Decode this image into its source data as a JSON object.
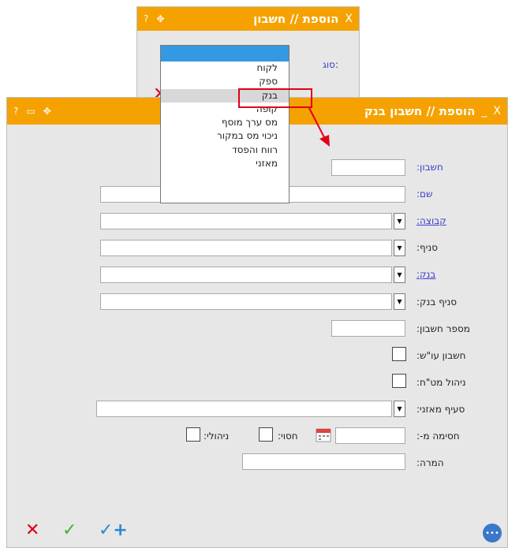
{
  "type_dialog": {
    "title": "הוספת // חשבון",
    "close": "X",
    "help": "?",
    "move": "✥",
    "type_label": "סוג:",
    "cancel_icon": "✕"
  },
  "type_dropdown": {
    "options": [
      "לקוח",
      "ספק",
      "בנק",
      "קופה",
      "מס ערך מוסף",
      "ניכוי מס במקור",
      "רווח והפסד",
      "מאזני"
    ],
    "highlighted": "בנק"
  },
  "bank_dialog": {
    "title": "הוספת // חשבון בנק",
    "close": "X",
    "minimize": "_",
    "help": "?",
    "print": "▭",
    "move": "✥",
    "labels": {
      "account": "חשבון:",
      "name": "שם:",
      "group": "קבוצה:",
      "branch": "סניף:",
      "bank": "בנק:",
      "bank_branch": "סניף בנק:",
      "account_number": "מספר חשבון:",
      "account_osh": "חשבון עו\"ש:",
      "fx_management": "ניהול מט\"ח:",
      "balance_item": "סעיף מאזני:",
      "block_from": "חסימה מ-:",
      "blocked": "חסוי:",
      "managed": "ניהולי:",
      "conversion": "המרה:"
    },
    "values": {
      "account": "",
      "name": "",
      "group": "",
      "branch": "",
      "bank": "",
      "bank_branch": "",
      "account_number": "",
      "balance_item": "",
      "block_from": "",
      "conversion": ""
    },
    "bottom": {
      "cancel": "✕",
      "confirm": "✓",
      "confirm_add": "✓+",
      "chat": "•••"
    }
  },
  "colors": {
    "title_bar": "#f5a200",
    "label_blue": "#3c3ccc",
    "cancel_red": "#e0001a",
    "confirm_green": "#3cb43c",
    "confirm_add_blue": "#2a8ad0",
    "dialog_bg": "#e7e7e7",
    "list_selected": "#3399e0"
  }
}
